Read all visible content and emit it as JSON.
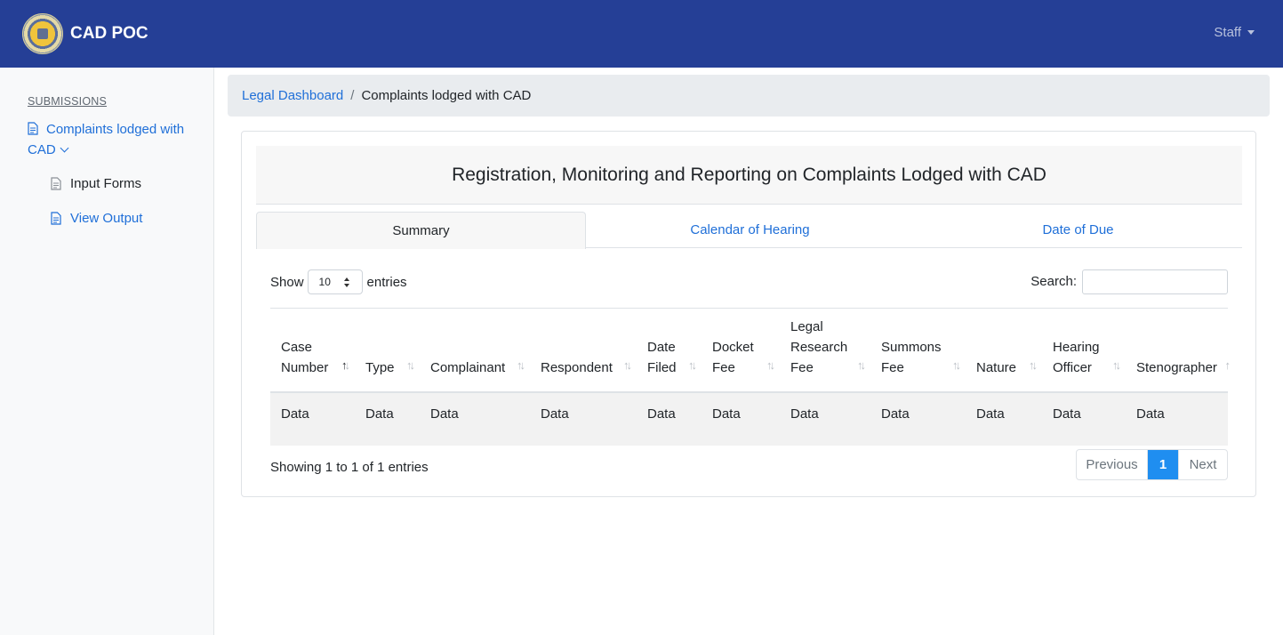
{
  "navbar": {
    "brand": "CAD POC",
    "user_menu": "Staff"
  },
  "sidebar": {
    "heading": "SUBMISSIONS",
    "main_item": "Complaints lodged with CAD",
    "sub_items": [
      "Input Forms",
      "View Output"
    ]
  },
  "breadcrumb": {
    "parent": "Legal Dashboard",
    "separator": "/",
    "current": "Complaints lodged with CAD"
  },
  "card": {
    "title": "Registration, Monitoring and Reporting on Complaints Lodged with CAD",
    "tabs": [
      "Summary",
      "Calendar of Hearing",
      "Date of Due"
    ],
    "active_tab": "Summary"
  },
  "table_controls": {
    "show_label": "Show",
    "entries_value": "10",
    "entries_label": "entries",
    "search_label": "Search:",
    "search_value": ""
  },
  "table": {
    "columns": [
      "Case Number",
      "Type",
      "Complainant",
      "Respondent",
      "Date Filed",
      "Docket Fee",
      "Legal Research Fee",
      "Summons Fee",
      "Nature",
      "Hearing Officer",
      "Stenographer"
    ],
    "rows": [
      [
        "Data",
        "Data",
        "Data",
        "Data",
        "Data",
        "Data",
        "Data",
        "Data",
        "Data",
        "Data",
        "Data"
      ]
    ]
  },
  "footer": {
    "info": "Showing 1 to 1 of 1 entries",
    "previous": "Previous",
    "current_page": "1",
    "next": "Next"
  },
  "colors": {
    "navbar": "#253f96",
    "link": "#1f6fd8",
    "active_page": "#1f8ef0"
  }
}
